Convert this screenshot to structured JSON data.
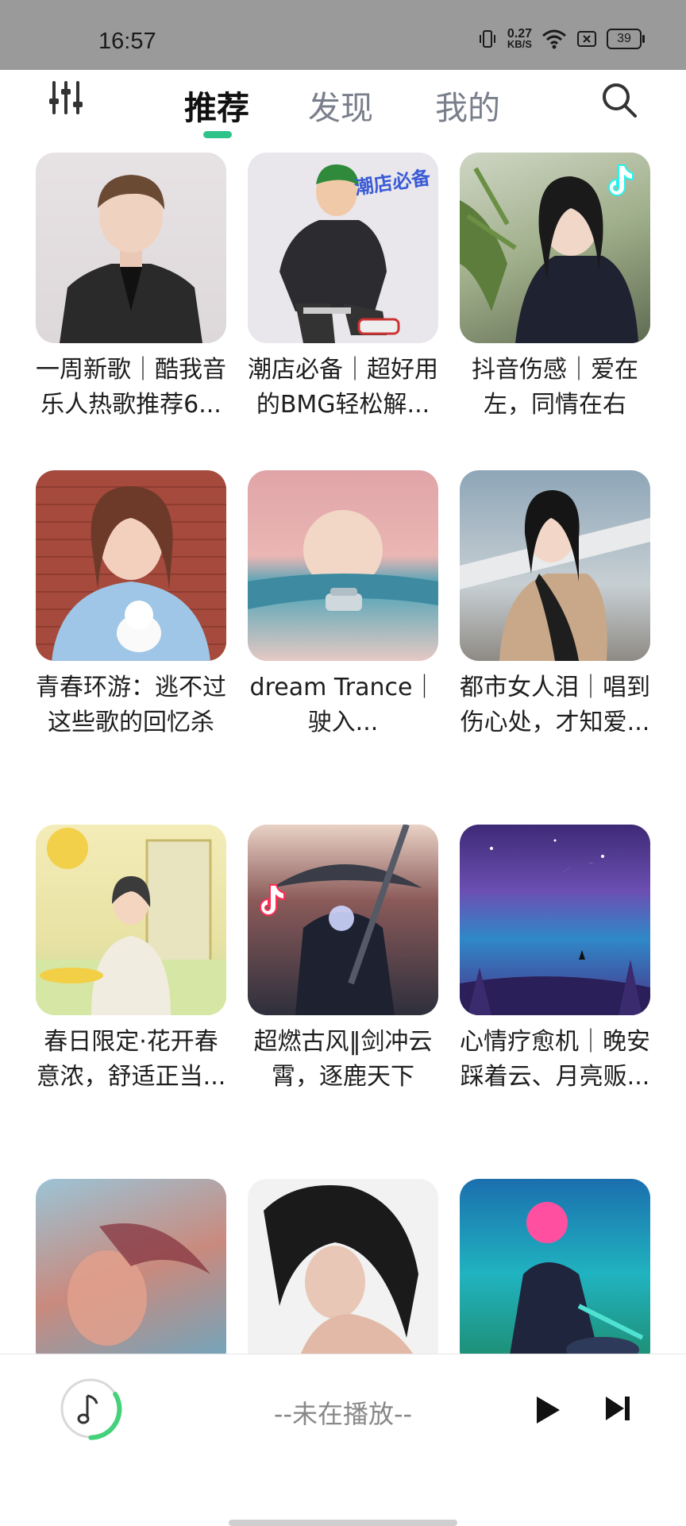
{
  "status_bar": {
    "time": "16:57",
    "net_speed_value": "0.27",
    "net_speed_unit": "KB/S",
    "battery": "39"
  },
  "nav": {
    "tabs": [
      {
        "label": "推荐",
        "active": true
      },
      {
        "label": "发现",
        "active": false
      },
      {
        "label": "我的",
        "active": false
      }
    ],
    "accent_color": "#2fc38a",
    "left_icon": "equalizer-icon",
    "right_icon": "search-icon"
  },
  "playlists": [
    {
      "title": "一周新歌｜酷我音乐人热歌推荐6..."
    },
    {
      "title": "潮店必备｜超好用的BMG轻松解...",
      "cover_text": "潮店必备"
    },
    {
      "title": "抖音伤感｜爱在左，同情在右"
    },
    {
      "title": "青春环游：逃不过这些歌的回忆杀"
    },
    {
      "title": "dream Trance｜驶入..."
    },
    {
      "title": "都市女人泪｜唱到伤心处，才知爱..."
    },
    {
      "title": "春日限定·花开春意浓，舒适正当..."
    },
    {
      "title": "超燃古风‖剑冲云霄，逐鹿天下"
    },
    {
      "title": "心情疗愈机｜晚安踩着云、月亮贩..."
    },
    {
      "title": ""
    },
    {
      "title": ""
    },
    {
      "title": ""
    }
  ],
  "player": {
    "status_text": "--未在播放--",
    "icons": [
      "music-disc-icon",
      "play-icon",
      "next-icon"
    ]
  }
}
